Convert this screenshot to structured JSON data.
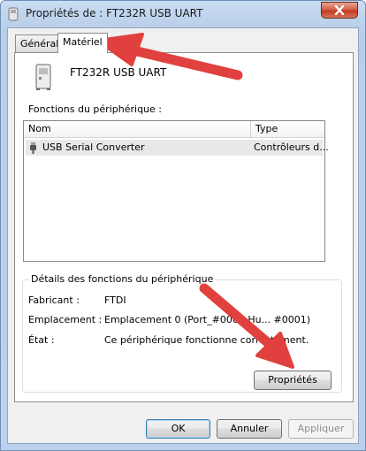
{
  "window": {
    "title": "Propriétés de : FT232R USB UART"
  },
  "tabs": [
    {
      "label": "Général"
    },
    {
      "label": "Matériel"
    }
  ],
  "device": {
    "name": "FT232R USB UART"
  },
  "functions": {
    "label": "Fonctions du périphérique :",
    "columns": [
      "Nom",
      "Type"
    ],
    "rows": [
      {
        "name": "USB Serial Converter",
        "type": "Contrôleurs d..."
      }
    ]
  },
  "details": {
    "title": "Détails des fonctions du périphérique",
    "manufacturer_label": "Fabricant :",
    "manufacturer_value": "FTDI",
    "location_label": "Emplacement :",
    "location_value": "Emplacement 0 (Port_#0003.Hu... #0001)",
    "state_label": "État :",
    "state_value": "Ce périphérique fonctionne correctement."
  },
  "buttons": {
    "properties": "Propriétés",
    "ok": "OK",
    "cancel": "Annuler",
    "apply": "Appliquer"
  },
  "colors": {
    "annotation_arrow": "#e0413e"
  }
}
